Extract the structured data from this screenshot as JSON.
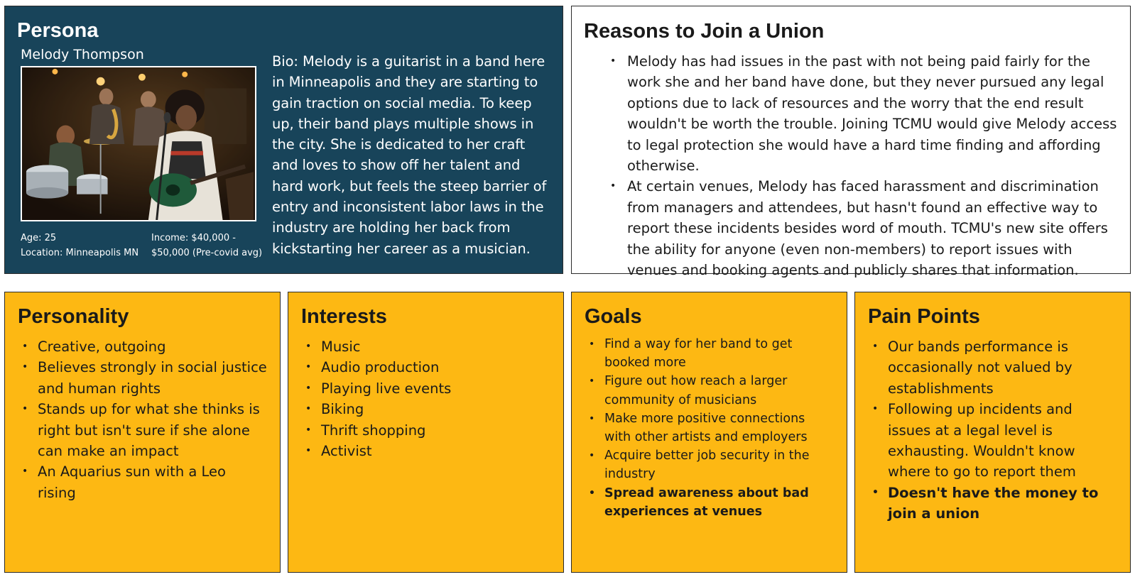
{
  "persona": {
    "title": "Persona",
    "name": "Melody Thompson",
    "age": "Age: 25",
    "location": "Location: Minneapolis MN",
    "income_line1": "Income: $40,000 -",
    "income_line2": "$50,000 (Pre-covid avg)",
    "bio": "Bio: Melody is a guitarist in a band here in Minneapolis and they are starting to gain traction on social media. To keep up, their band plays multiple shows in the city. She is dedicated to her craft and loves to show off her talent and hard work, but feels the steep barrier of entry and inconsistent labor laws in the industry are holding her back from kickstarting her career as a musician."
  },
  "reasons": {
    "title": "Reasons to Join a Union",
    "items": [
      "Melody has had issues in the past with not being paid fairly for the work she and her band have done, but they never pursued any legal options due to lack of resources and the worry that the end result wouldn't be worth the trouble. Joining TCMU would give Melody access to legal protection she would have a hard time finding and affording otherwise.",
      "At certain venues, Melody has faced harassment and discrimination from managers and attendees, but hasn't found an effective way to report these incidents besides word of mouth. TCMU's new site offers the ability for anyone (even non-members) to report issues with venues and booking agents and publicly shares that information."
    ]
  },
  "personality": {
    "title": "Personality",
    "items": [
      "Creative, outgoing",
      "Believes strongly in social justice and human rights",
      "Stands up for what she thinks is right but isn't sure if she alone can make an impact",
      "An Aquarius sun with a Leo rising"
    ]
  },
  "interests": {
    "title": "Interests",
    "items": [
      "Music",
      "Audio production",
      "Playing live events",
      "Biking",
      "Thrift shopping",
      "Activist"
    ]
  },
  "goals": {
    "title": "Goals",
    "items": [
      "Find a way for her band to get booked more",
      "Figure out how reach a larger community of musicians",
      "Make more positive connections with other artists and employers",
      "Acquire better job security in the industry",
      "Spread awareness about bad experiences at venues"
    ]
  },
  "pain_points": {
    "title": "Pain Points",
    "items": [
      "Our bands performance is occasionally not valued by establishments",
      "Following up incidents and issues at a legal level is exhausting. Wouldn't know where to go to report them",
      "Doesn't have the money to join a union"
    ]
  },
  "colors": {
    "persona_bg": "#18445a",
    "card_bg": "#fdb813",
    "reasons_bg": "#ffffff"
  }
}
